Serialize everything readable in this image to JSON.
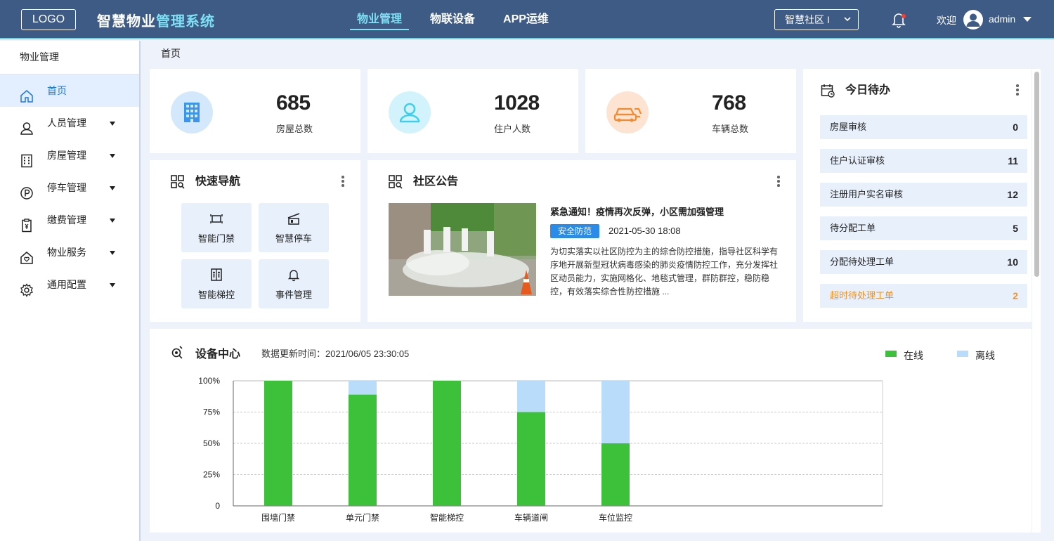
{
  "header": {
    "logo": "LOGO",
    "brand_a": "智慧物业",
    "brand_b": "管理系统",
    "nav": [
      "物业管理",
      "物联设备",
      "APP运维"
    ],
    "community": "智慧社区 I",
    "welcome": "欢迎",
    "user": "admin"
  },
  "sidebar": {
    "title": "物业管理",
    "items": [
      {
        "label": "首页"
      },
      {
        "label": "人员管理"
      },
      {
        "label": "房屋管理"
      },
      {
        "label": "停车管理"
      },
      {
        "label": "缴费管理"
      },
      {
        "label": "物业服务"
      },
      {
        "label": "通用配置"
      }
    ]
  },
  "breadcrumb": "首页",
  "stats": [
    {
      "value": "685",
      "label": "房屋总数",
      "color": "#d4e8fc"
    },
    {
      "value": "1028",
      "label": "住户人数",
      "color": "#d2f3fb"
    },
    {
      "value": "768",
      "label": "车辆总数",
      "color": "#fde4d2"
    }
  ],
  "quick_nav": {
    "title": "快速导航",
    "items": [
      "智能门禁",
      "智慧停车",
      "智能梯控",
      "事件管理"
    ]
  },
  "notice": {
    "title": "社区公告",
    "headline": "紧急通知！疫情再次反弹，小区需加强管理",
    "tag": "安全防范",
    "date": "2021-05-30 18:08",
    "body": "为切实落实以社区防控为主的綜合防控措施，指导社区科学有序地开展新型冠状病毒感染的肺炎疫情防控工作，充分发挥社区动员能力，实施网格化、地毯式管理，群防群控，稳防稳控，有效落实综合性防控措施 ..."
  },
  "todo": {
    "title": "今日待办",
    "items": [
      {
        "label": "房屋审核",
        "count": "0"
      },
      {
        "label": "住户认证审核",
        "count": "11"
      },
      {
        "label": "注册用户实名审核",
        "count": "12"
      },
      {
        "label": "待分配工单",
        "count": "5"
      },
      {
        "label": "分配待处理工单",
        "count": "10"
      },
      {
        "label": "超时待处理工单",
        "count": "2"
      }
    ]
  },
  "devices": {
    "title": "设备中心",
    "update": "数据更新时间：2021/06/05   23:30:05"
  },
  "chart_data": {
    "type": "bar",
    "stacked": true,
    "categories": [
      "围墙门禁",
      "单元门禁",
      "智能梯控",
      "车辆道闸",
      "车位监控"
    ],
    "series": [
      {
        "name": "在线",
        "values": [
          100,
          89,
          100,
          75,
          50
        ],
        "color": "#3ec13a"
      },
      {
        "name": "离线",
        "values": [
          0,
          11,
          0,
          25,
          50
        ],
        "color": "#b8dcfa"
      }
    ],
    "yticks": [
      "0",
      "25%",
      "50%",
      "75%",
      "100%"
    ],
    "ylim": [
      0,
      100
    ],
    "legend_position": "top-right",
    "grid": true
  }
}
